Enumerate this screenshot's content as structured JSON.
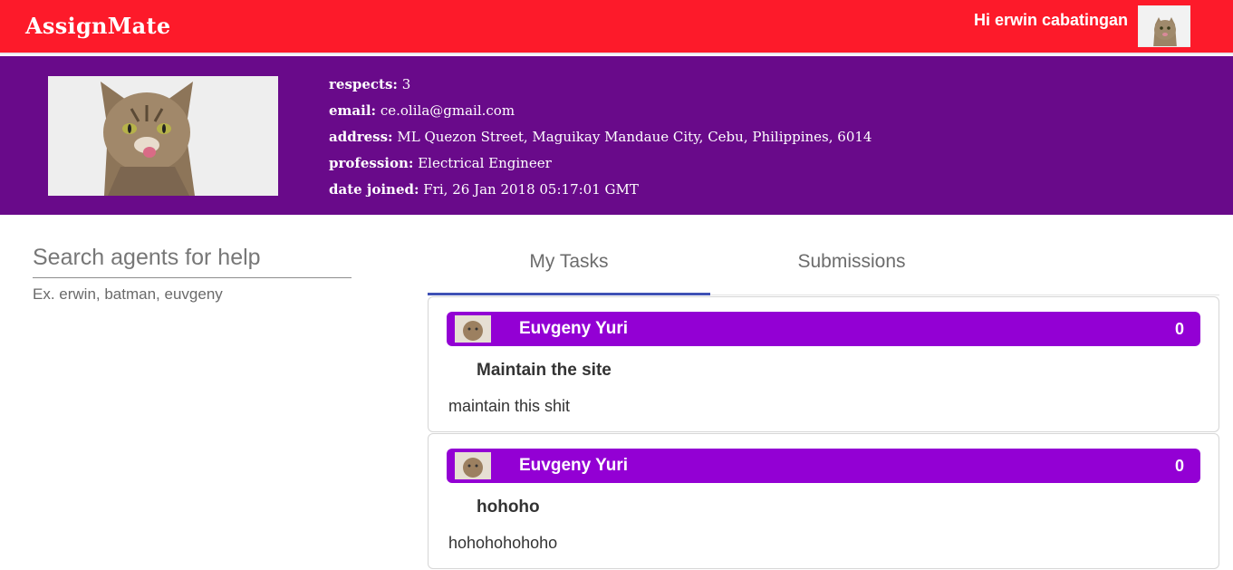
{
  "header": {
    "brand": "AssignMate",
    "greeting": "Hi erwin cabatingan"
  },
  "profile": {
    "respects_label": "respects:",
    "respects": "3",
    "email_label": "email:",
    "email": "ce.olila@gmail.com",
    "address_label": "address:",
    "address": "ML Quezon Street, Maguikay Mandaue City, Cebu, Philippines, 6014",
    "profession_label": "profession:",
    "profession": "Electrical Engineer",
    "date_joined_label": "date joined:",
    "date_joined": "Fri, 26 Jan 2018 05:17:01 GMT"
  },
  "search": {
    "placeholder": "Search agents for help",
    "hint": "Ex. erwin, batman, euvgeny"
  },
  "tabs": [
    {
      "label": "My Tasks",
      "active": true
    },
    {
      "label": "Submissions",
      "active": false
    }
  ],
  "tasks": [
    {
      "agent": "Euvgeny Yuri",
      "count": "0",
      "title": "Maintain the site",
      "description": "maintain this shit"
    },
    {
      "agent": "Euvgeny Yuri",
      "count": "0",
      "title": "hohoho",
      "description": "hohohohohoho"
    }
  ],
  "colors": {
    "topbar": "#fd1a2a",
    "profile_band": "#690a8a",
    "card_header": "#9300d4",
    "tab_indicator": "#3f51b5"
  },
  "icons": {
    "user_avatar": "cat-avatar-icon",
    "profile_photo": "cat-photo"
  }
}
